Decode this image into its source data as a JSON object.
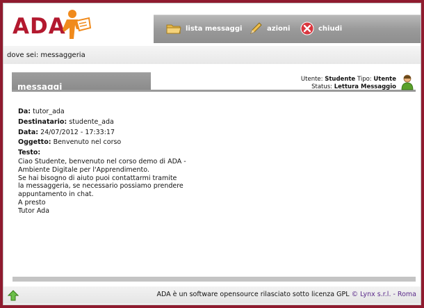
{
  "app": {
    "logo_text": "ADA"
  },
  "nav": {
    "items": [
      {
        "label": "lista messaggi",
        "icon": "folder-icon"
      },
      {
        "label": "azioni",
        "icon": "pencil-icon"
      },
      {
        "label": "chiudi",
        "icon": "close-icon"
      }
    ]
  },
  "breadcrumb": "dove sei: messaggeria",
  "section": {
    "title": "messaggi"
  },
  "user": {
    "utente_label": "Utente:",
    "utente_value": "Studente",
    "tipo_label": "Tipo:",
    "tipo_value": "Utente",
    "status_label": "Status:",
    "status_value": "Lettura Messaggio"
  },
  "message": {
    "da_label": "Da:",
    "da_value": "tutor_ada",
    "dest_label": "Destinatario:",
    "dest_value": "studente_ada",
    "data_label": "Data:",
    "data_value": "24/07/2012 - 17:33:17",
    "oggetto_label": "Oggetto:",
    "oggetto_value": "Benvenuto nel corso",
    "testo_label": "Testo:",
    "testo_value": "Ciao Studente, benvenuto nel corso demo di ADA -\nAmbiente Digitale per l'Apprendimento.\nSe hai bisogno di aiuto puoi contattarmi tramite\nla messaggeria, se necessario possiamo prendere\nappuntamento in chat.\nA presto\nTutor Ada"
  },
  "footer": {
    "text": "ADA è un software opensource rilasciato sotto licenza GPL",
    "link": "© Lynx s.r.l. - Roma"
  },
  "colors": {
    "brand": "#b3192f",
    "frame": "#8f1b2f",
    "nav": "#9a9a9a"
  }
}
